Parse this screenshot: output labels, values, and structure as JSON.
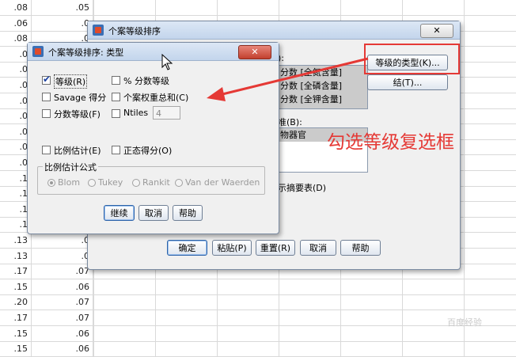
{
  "spreadsheet": {
    "rows": [
      {
        "a": ".08",
        "b": ".05"
      },
      {
        "a": ".06",
        "b": ".0"
      },
      {
        "a": ".08",
        "b": ".0"
      },
      {
        "a": ".0",
        "b": ".0"
      },
      {
        "a": ".0",
        "b": ".0"
      },
      {
        "a": ".0",
        "b": ".0"
      },
      {
        "a": ".0",
        "b": ".0"
      },
      {
        "a": ".0",
        "b": ".0"
      },
      {
        "a": ".0",
        "b": ".0"
      },
      {
        "a": ".0",
        "b": ".0"
      },
      {
        "a": ".0",
        "b": ".0"
      },
      {
        "a": ".1",
        "b": ".0"
      },
      {
        "a": ".1",
        "b": ".0"
      },
      {
        "a": ".1",
        "b": ".0"
      },
      {
        "a": ".1",
        "b": ".0"
      },
      {
        "a": ".13",
        "b": ".0"
      },
      {
        "a": ".13",
        "b": ".0"
      },
      {
        "a": ".17",
        "b": ".07"
      },
      {
        "a": ".15",
        "b": ".06"
      },
      {
        "a": ".20",
        "b": ".07"
      },
      {
        "a": ".17",
        "b": ".07"
      },
      {
        "a": ".15",
        "b": ".06"
      },
      {
        "a": ".15",
        "b": ".06"
      }
    ]
  },
  "main_dialog": {
    "title": "个案等级排序",
    "variables_label_suffix": "):",
    "variables": [
      "分数 [全氮含量]",
      "分数 [全磷含量]",
      "分数 [全钾含量]"
    ],
    "by_label": "准(B):",
    "by_items": [
      "物器官"
    ],
    "summary_label": "示摘要表(D)",
    "rank_types_button": "等级的类型(K)...",
    "ties_button": "结(T)...",
    "ok": "确定",
    "paste": "粘贴(P)",
    "reset": "重置(R)",
    "cancel": "取消",
    "help": "帮助"
  },
  "sub_dialog": {
    "title": "个案等级排序: 类型",
    "options": {
      "rank": {
        "label": "等级(R)",
        "checked": true
      },
      "percent_rank": {
        "label": "% 分数等级",
        "checked": false
      },
      "savage": {
        "label": "Savage 得分",
        "checked": false
      },
      "case_weight_sum": {
        "label": "个案权重总和(C)",
        "checked": false
      },
      "fractional_rank": {
        "label": "分数等级(F)",
        "checked": false
      },
      "ntiles": {
        "label": "Ntiles",
        "checked": false,
        "value": "4"
      },
      "proportion": {
        "label": "比例估计(E)",
        "checked": false
      },
      "normal_scores": {
        "label": "正态得分(O)",
        "checked": false
      }
    },
    "formula_group": "比例估计公式",
    "formulas": [
      "Blom",
      "Tukey",
      "Rankit",
      "Van der Waerden"
    ],
    "continue": "继续",
    "cancel": "取消",
    "help": "帮助"
  },
  "annotation": {
    "text": "勾选等级复选框",
    "color": "#e53935"
  },
  "watermark": "百度经验",
  "colors": {
    "highlight": "#e53935",
    "title_gradient": "#c3d5ec"
  }
}
